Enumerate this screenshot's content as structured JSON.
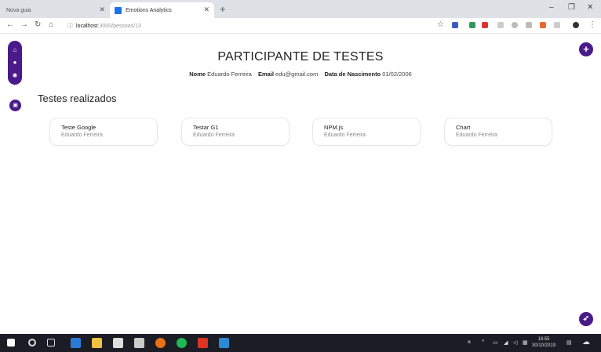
{
  "browser": {
    "tabs": [
      {
        "label": "Nova guia",
        "active": false
      },
      {
        "label": "Emotions Analytics",
        "active": true
      }
    ],
    "address": {
      "host": "localhost",
      "path": ":3000/pessoas/13"
    }
  },
  "page": {
    "title": "PARTICIPANTE DE TESTES",
    "meta": {
      "name_label": "Nome",
      "name_value": "Eduardo Ferreira",
      "email_label": "Email",
      "email_value": "edu@gmail.com",
      "dob_label": "Data de Nascimento",
      "dob_value": "01/02/2006"
    },
    "section_title": "Testes realizados",
    "tests": [
      {
        "title": "Teste Google",
        "person": "Eduardo Ferreira"
      },
      {
        "title": "Testar G1",
        "person": "Eduardo Ferreira"
      },
      {
        "title": "NPM.js",
        "person": "Eduardo Ferreira"
      },
      {
        "title": "Chart",
        "person": "Eduardo Ferreira"
      }
    ]
  },
  "taskbar": {
    "time": "18:55",
    "date": "30/10/2019"
  },
  "colors": {
    "accent": "#4a1a8a"
  }
}
